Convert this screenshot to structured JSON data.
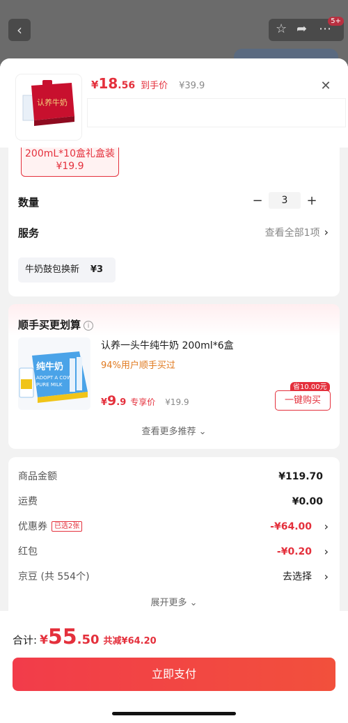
{
  "background": {
    "back_icon": "chevron-left-icon",
    "badge": "5+"
  },
  "product": {
    "price_int": "18",
    "price_dec": ".56",
    "price_tag": "到手价",
    "original_price": "¥39.9",
    "currency": "¥",
    "thumbnail_text": "认养牛奶"
  },
  "variant": {
    "line1": "200mL*10盒礼盒装",
    "line2": "¥19.9"
  },
  "quantity": {
    "label": "数量",
    "minus": "−",
    "value": "3",
    "plus": "+"
  },
  "service": {
    "label": "服务",
    "link": "查看全部1项",
    "chip_name": "牛奶鼓包换新",
    "chip_price": "¥3"
  },
  "addon": {
    "title": "顺手买更划算",
    "info_icon": "i",
    "name": "认养一头牛纯牛奶 200ml*6盒",
    "subtitle": "94%用户顺手买过",
    "price_int": "9",
    "price_dec": ".9",
    "price_tag": "专享价",
    "original_price": "¥19.9",
    "save_tag": "省10.00元",
    "buy_label": "一键购买",
    "more_label": "查看更多推荐",
    "image_text_1": "纯牛奶",
    "image_text_2": "ADOPT A COW",
    "image_text_3": "PURE MILK"
  },
  "fees": {
    "rows": [
      {
        "label": "商品金额",
        "amount": "¥119.70"
      },
      {
        "label": "运费",
        "amount": "¥0.00"
      },
      {
        "label": "优惠券",
        "tag": "已选2张",
        "amount": "-¥64.00"
      },
      {
        "label": "红包",
        "amount": "-¥0.20"
      },
      {
        "label": "京豆 (共 554个)",
        "amount": "去选择"
      }
    ],
    "expand_label": "展开更多"
  },
  "footer": {
    "total_label": "合计:",
    "currency": "¥",
    "total_int": "55",
    "total_dec": ".50",
    "reduction": "共减¥64.20",
    "pay_label": "立即支付"
  },
  "colors": {
    "accent": "#e4303c",
    "orange": "#e07a20"
  }
}
